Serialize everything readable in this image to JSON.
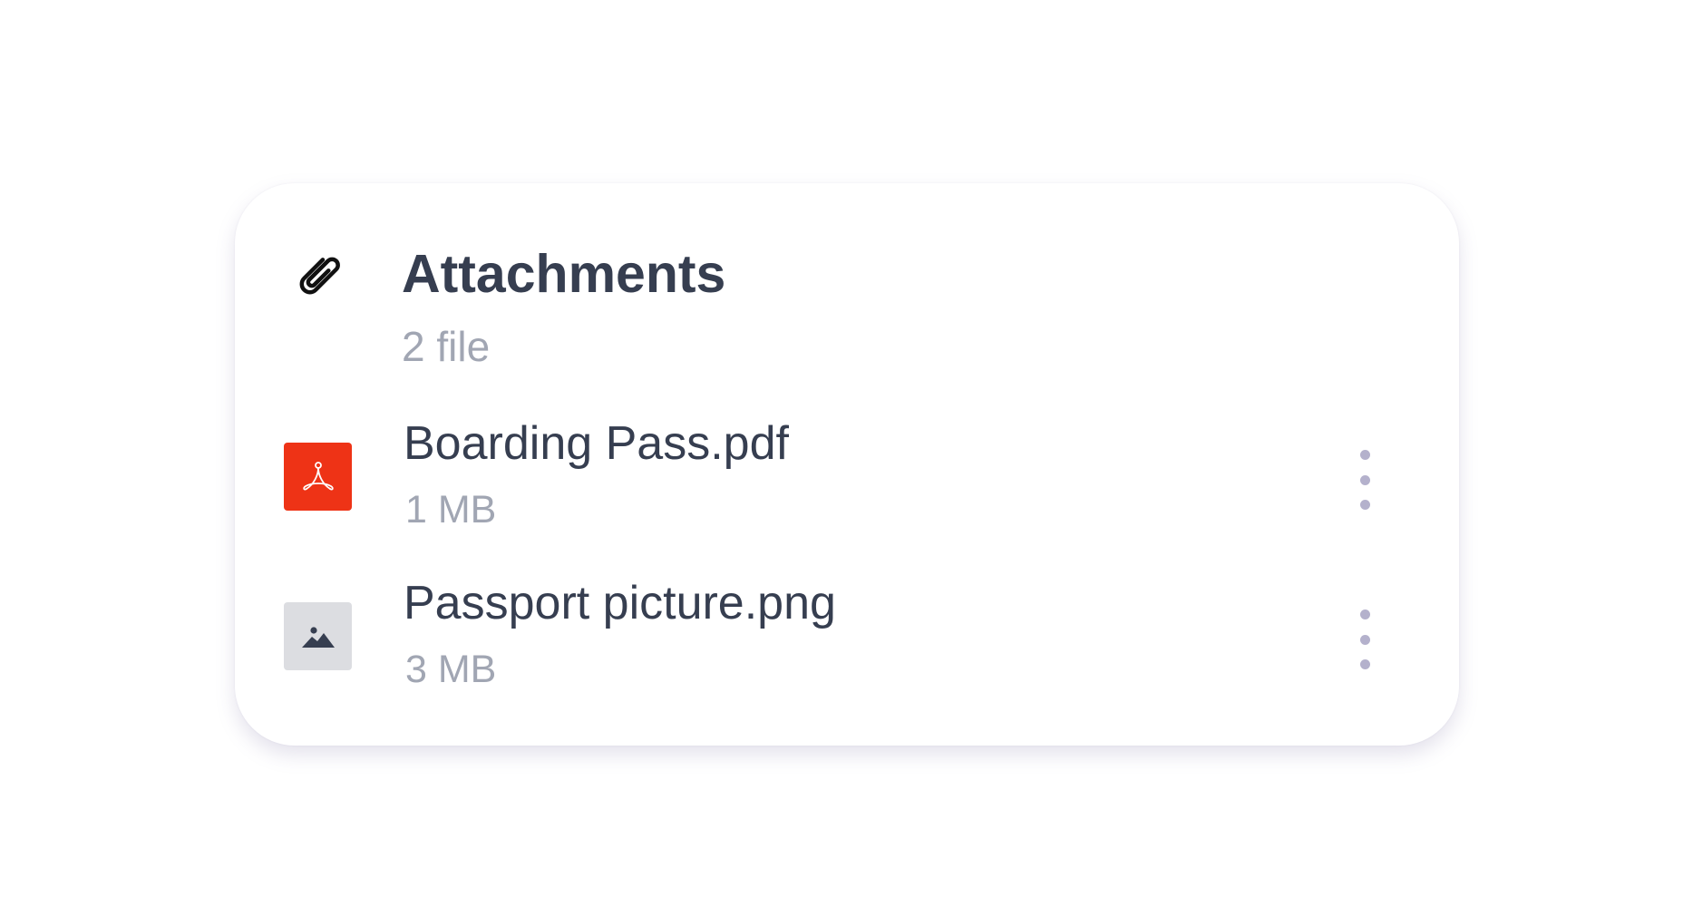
{
  "attachments": {
    "header_icon": "paperclip-icon",
    "title": "Attachments",
    "count_label": "2 file",
    "files": [
      {
        "name": "Boarding Pass.pdf",
        "size": "1 MB",
        "icon": "pdf-file-icon",
        "thumb_color": "#ee3316",
        "menu_icon": "more-vertical-icon"
      },
      {
        "name": "Passport picture.png",
        "size": "3 MB",
        "icon": "image-file-icon",
        "thumb_color": "#dcdde1",
        "menu_icon": "more-vertical-icon"
      }
    ]
  },
  "colors": {
    "title": "#363e50",
    "secondary_text": "#a1a6b3",
    "menu_dots": "#b4b1cc",
    "background": "#ffffff"
  }
}
